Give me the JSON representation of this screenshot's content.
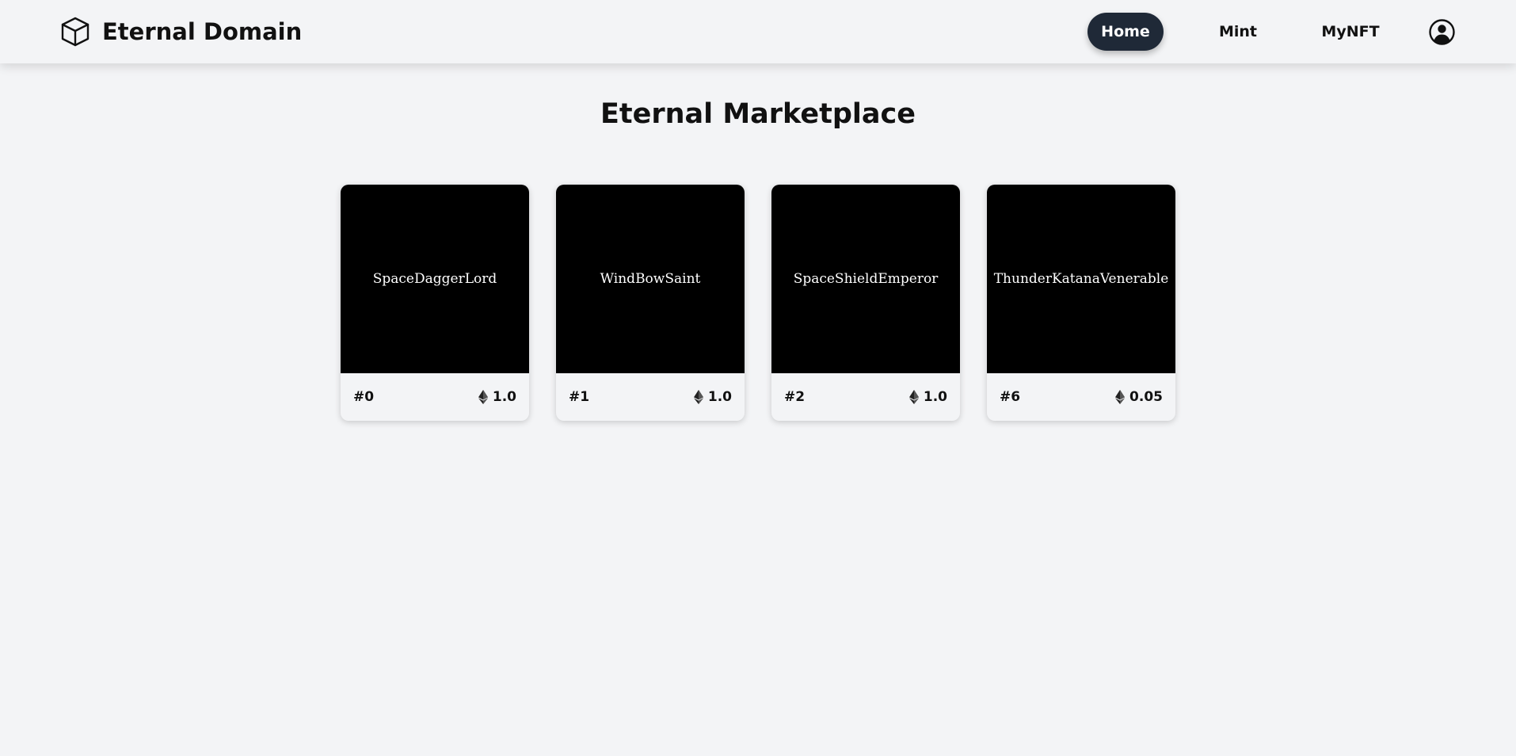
{
  "header": {
    "brand": {
      "title": "Eternal Domain",
      "icon": "cube-icon"
    },
    "nav": [
      {
        "label": "Home",
        "active": true
      },
      {
        "label": "Mint",
        "active": false
      },
      {
        "label": "MyNFT",
        "active": false
      }
    ],
    "account_icon": "user-circle-icon"
  },
  "main": {
    "title": "Eternal Marketplace",
    "cards": [
      {
        "name": "SpaceDaggerLord",
        "id": "#0",
        "price": "1.0",
        "currency_icon": "ethereum-icon"
      },
      {
        "name": "WindBowSaint",
        "id": "#1",
        "price": "1.0",
        "currency_icon": "ethereum-icon"
      },
      {
        "name": "SpaceShieldEmperor",
        "id": "#2",
        "price": "1.0",
        "currency_icon": "ethereum-icon"
      },
      {
        "name": "ThunderKatanaVenerable",
        "id": "#6",
        "price": "0.05",
        "currency_icon": "ethereum-icon"
      }
    ]
  },
  "colors": {
    "background": "#f3f4f6",
    "nav_active": "#1f2937",
    "card_image": "#000000"
  }
}
